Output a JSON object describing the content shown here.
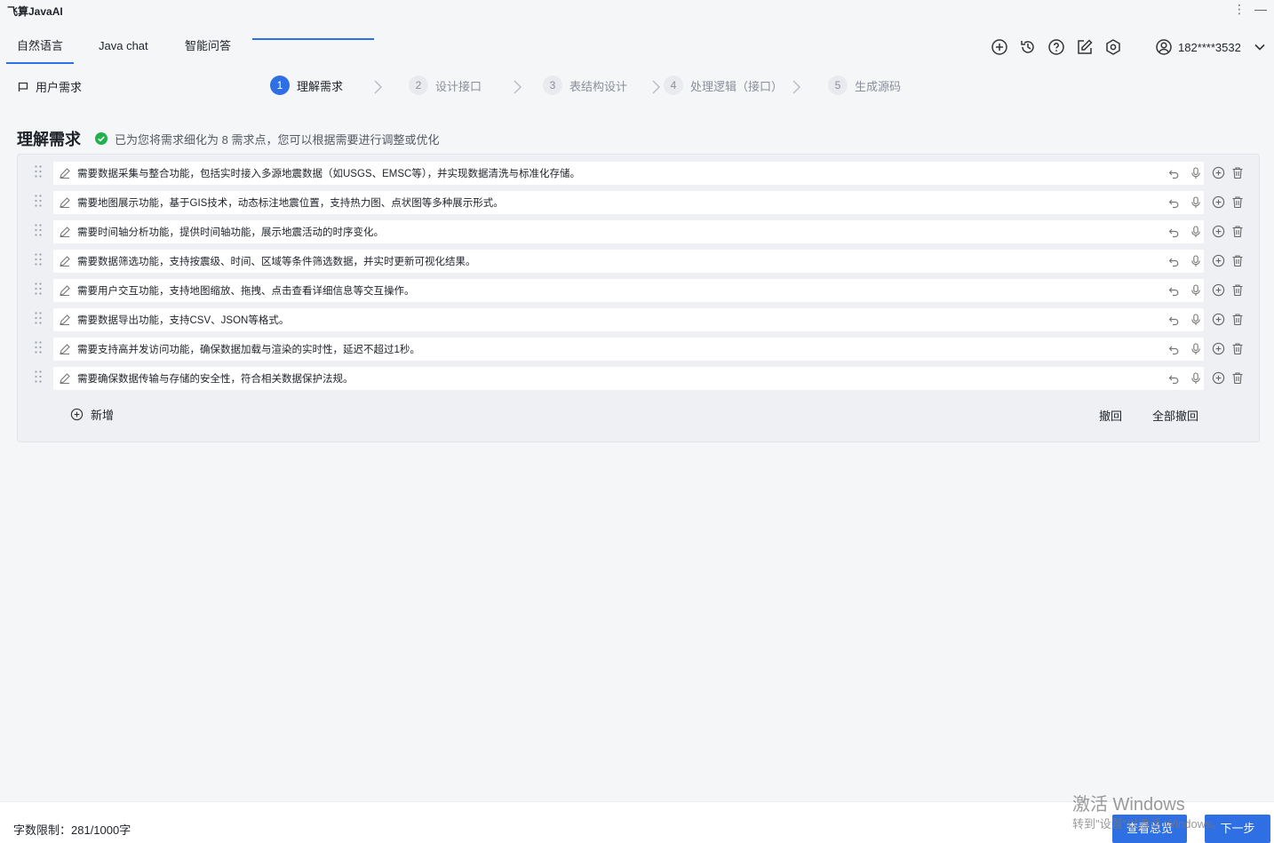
{
  "app": {
    "title": "飞算JavaAI"
  },
  "nav": {
    "tabs": [
      {
        "label": "自然语言",
        "active": true
      },
      {
        "label": "Java chat",
        "active": false
      },
      {
        "label": "智能问答",
        "active": false
      }
    ],
    "icons": [
      "plus-circle-icon",
      "history-icon",
      "help-icon",
      "edit-icon",
      "settings-icon"
    ],
    "user": {
      "phone": "182****3532",
      "icon": "user-circle-icon"
    }
  },
  "stepbar": {
    "user_requirement": "用户需求",
    "steps": [
      {
        "num": "1",
        "label": "理解需求",
        "active": true
      },
      {
        "num": "2",
        "label": "设计接口",
        "active": false
      },
      {
        "num": "3",
        "label": "表结构设计",
        "active": false
      },
      {
        "num": "4",
        "label": "处理逻辑（接口）",
        "active": false
      },
      {
        "num": "5",
        "label": "生成源码",
        "active": false
      }
    ]
  },
  "section": {
    "title": "理解需求",
    "message": "已为您将需求细化为 8 需求点，您可以根据需要进行调整或优化"
  },
  "requirements": [
    "需要数据采集与整合功能，包括实时接入多源地震数据（如USGS、EMSC等），并实现数据清洗与标准化存储。",
    "需要地图展示功能，基于GIS技术，动态标注地震位置，支持热力图、点状图等多种展示形式。",
    "需要时间轴分析功能，提供时间轴功能，展示地震活动的时序变化。",
    "需要数据筛选功能，支持按震级、时间、区域等条件筛选数据，并实时更新可视化结果。",
    "需要用户交互功能，支持地图缩放、拖拽、点击查看详细信息等交互操作。",
    "需要数据导出功能，支持CSV、JSON等格式。",
    "需要支持高并发访问功能，确保数据加载与渲染的实时性，延迟不超过1秒。",
    "需要确保数据传输与存储的安全性，符合相关数据保护法规。"
  ],
  "panel_actions": {
    "add": "新增",
    "undo": "撤回",
    "undo_all": "全部撤回"
  },
  "footer": {
    "char_limit": "字数限制：281/1000字",
    "overview_button": "查看总览",
    "next_button": "下一步"
  },
  "watermark": {
    "line1": "激活 Windows",
    "line2": "转到\"设置\"以激活 Windows。"
  },
  "colors": {
    "accent": "#2f6fe4",
    "success": "#22b14c",
    "background": "#f5f6f8"
  }
}
